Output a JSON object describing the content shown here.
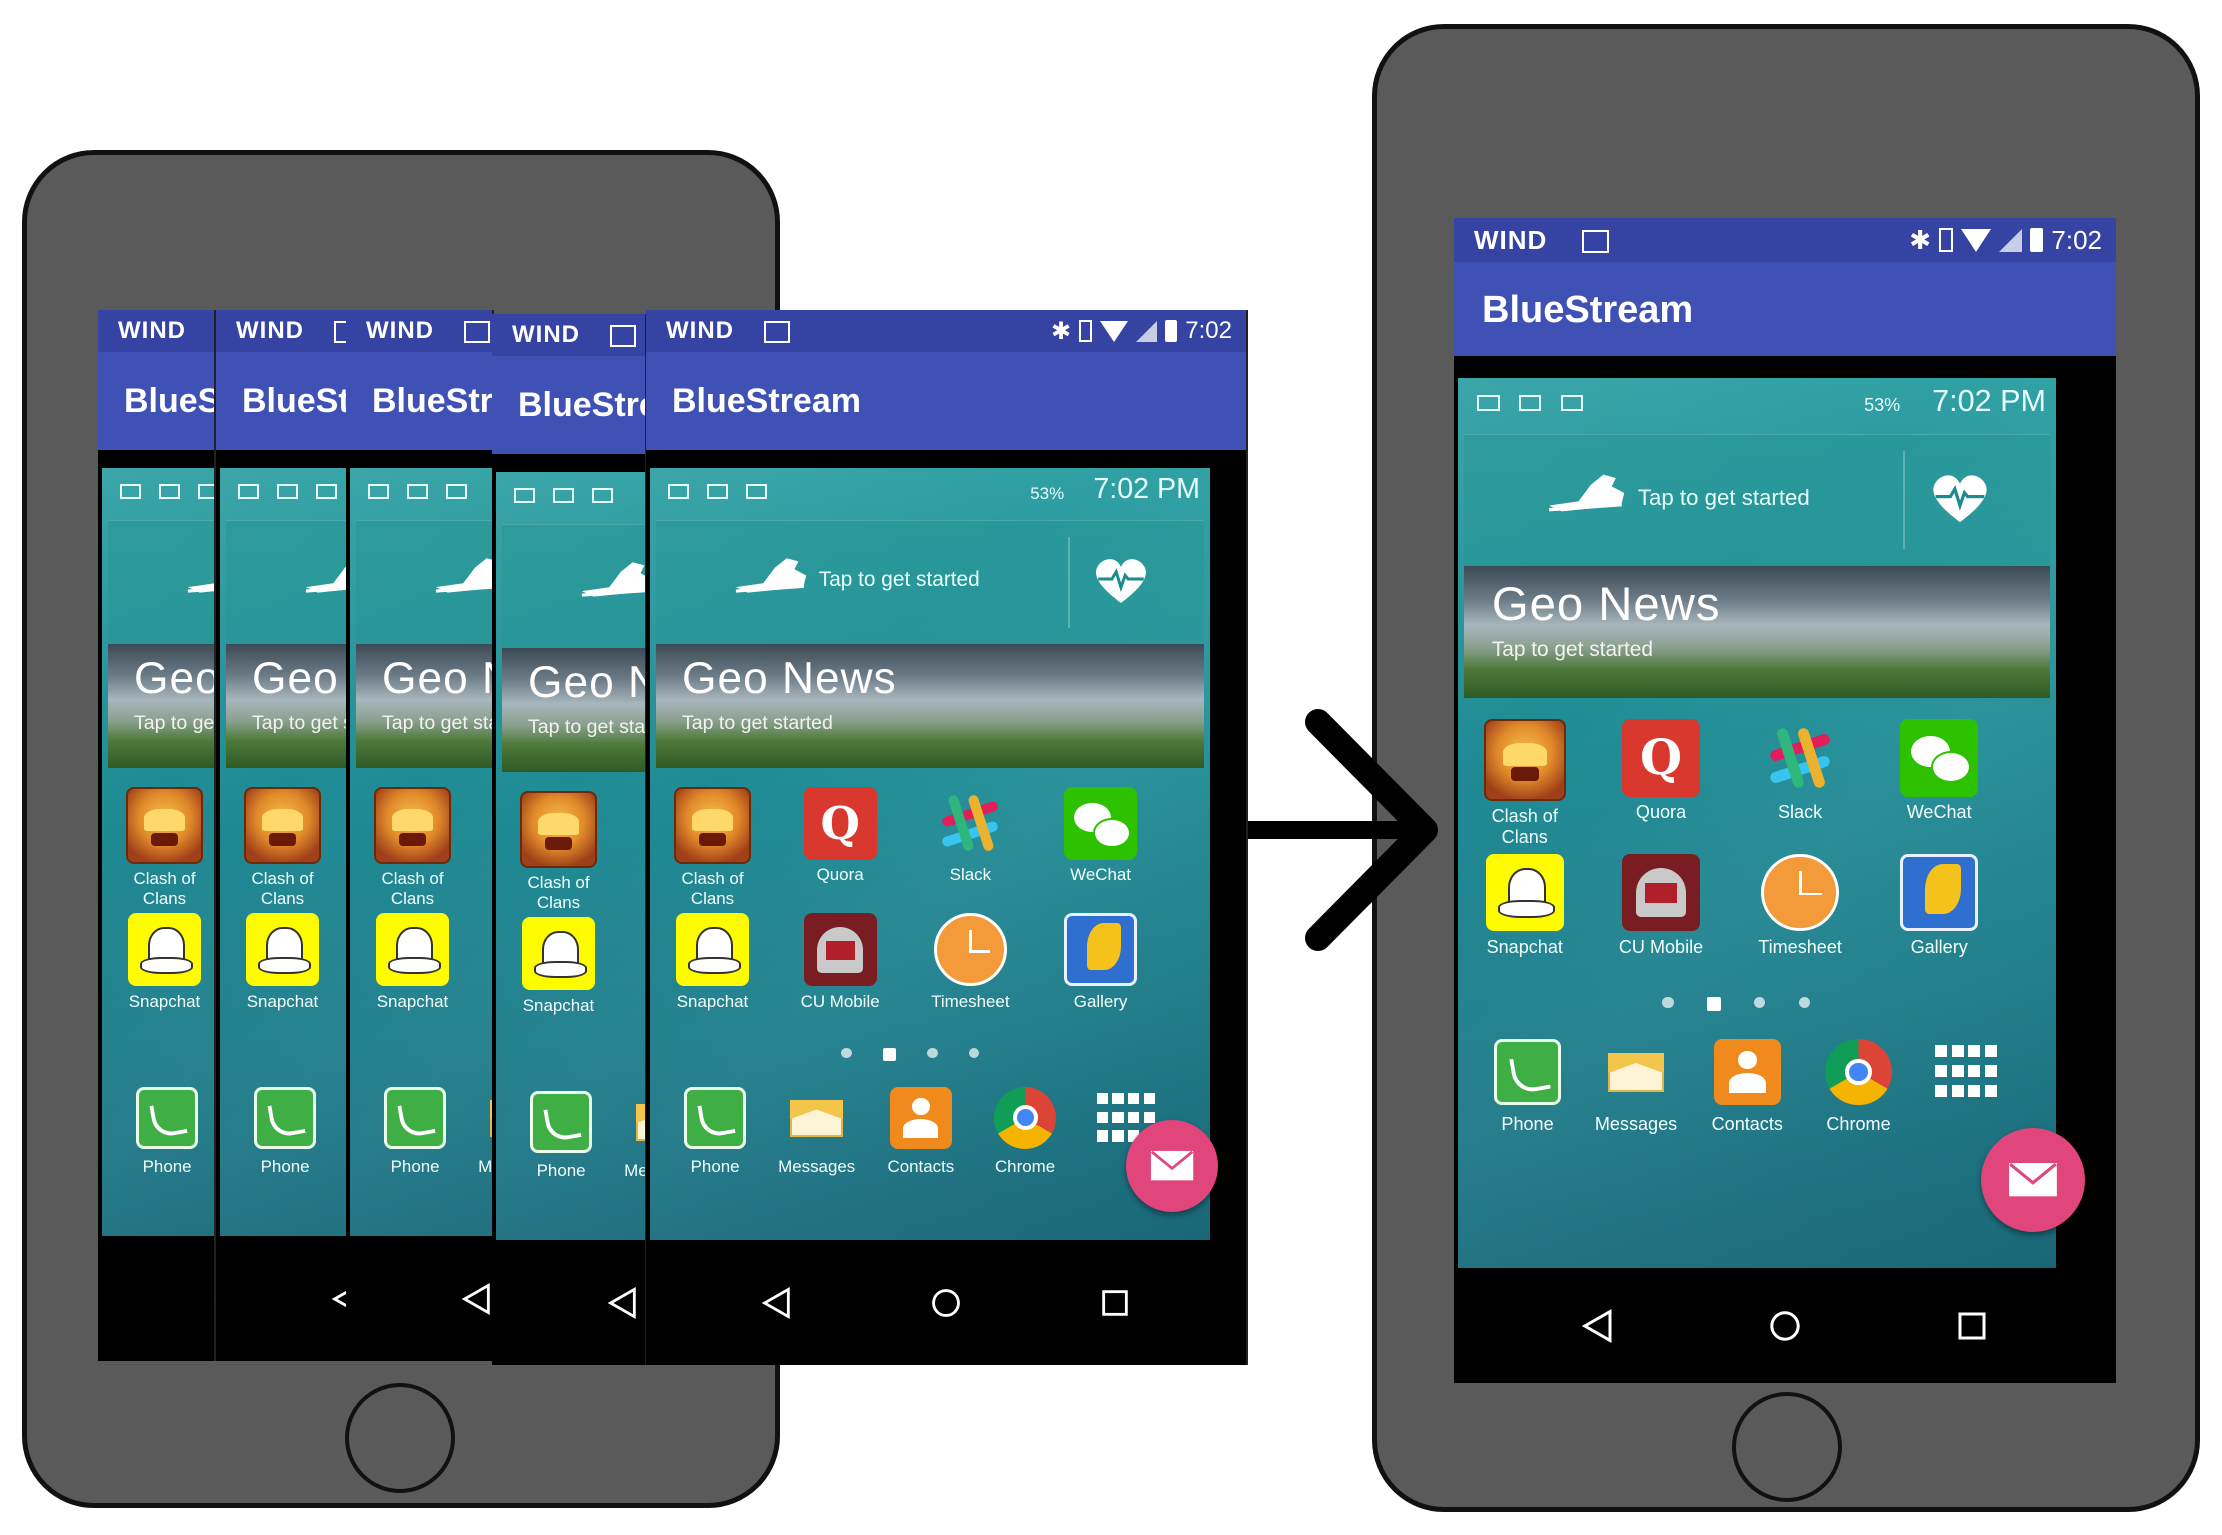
{
  "app": {
    "title": "BlueStream"
  },
  "status_bar": {
    "carrier": "WIND",
    "time": "7:02"
  },
  "inner_status": {
    "battery": "53%",
    "time": "7:02 PM"
  },
  "health_widget": {
    "tap_text": "Tap to get started"
  },
  "news_widget": {
    "title": "Geo News",
    "subtitle": "Tap to get started"
  },
  "apps_row1": [
    {
      "label": "Clash of\nClans",
      "icon": "clash-of-clans-icon"
    },
    {
      "label": "Quora",
      "icon": "quora-icon"
    },
    {
      "label": "Slack",
      "icon": "slack-icon"
    },
    {
      "label": "WeChat",
      "icon": "wechat-icon"
    }
  ],
  "apps_row2": [
    {
      "label": "Snapchat",
      "icon": "snapchat-icon"
    },
    {
      "label": "CU Mobile",
      "icon": "cu-mobile-icon"
    },
    {
      "label": "Timesheet",
      "icon": "timesheet-icon"
    },
    {
      "label": "Gallery",
      "icon": "gallery-icon"
    }
  ],
  "dock": [
    {
      "label": "Phone",
      "icon": "phone-icon"
    },
    {
      "label": "Messages",
      "icon": "messages-icon"
    },
    {
      "label": "Contacts",
      "icon": "contacts-icon"
    },
    {
      "label": "Chrome",
      "icon": "chrome-icon"
    },
    {
      "label": "",
      "icon": "apps-grid-icon"
    }
  ],
  "colors": {
    "status_bar": "#3543a3",
    "app_bar": "#3f51b5",
    "fab": "#e0457b",
    "phone_body": "#5a5a5a"
  }
}
